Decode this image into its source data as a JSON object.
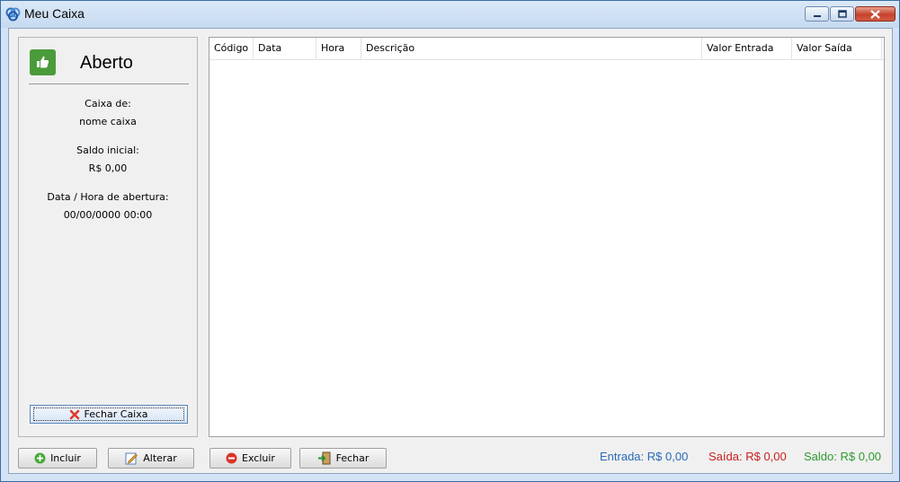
{
  "window": {
    "title": "Meu Caixa",
    "icon": "cash-register-app-icon"
  },
  "side_panel": {
    "status": "Aberto",
    "status_icon": "thumbs-up-icon",
    "status_color": "#4a9b3a",
    "caixa_label": "Caixa de:",
    "caixa_value": "nome caixa",
    "saldo_label": "Saldo inicial:",
    "saldo_value": "R$ 0,00",
    "abertura_label": "Data / Hora de abertura:",
    "abertura_value": "00/00/0000 00:00",
    "fechar_caixa_label": "Fechar Caixa"
  },
  "table": {
    "columns": [
      "Código",
      "Data",
      "Hora",
      "Descrição",
      "Valor Entrada",
      "Valor Saída"
    ],
    "rows": []
  },
  "buttons": {
    "incluir": "Incluir",
    "alterar": "Alterar",
    "excluir": "Excluir",
    "fechar": "Fechar"
  },
  "totals": {
    "entrada_label": "Entrada:",
    "entrada_value": "R$ 0,00",
    "entrada_color": "#2a6ab5",
    "saida_label": "Saída:",
    "saida_value": "R$ 0,00",
    "saida_color": "#c81e1e",
    "saldo_label": "Saldo:",
    "saldo_value": "R$ 0,00",
    "saldo_color": "#2e9a2e"
  }
}
